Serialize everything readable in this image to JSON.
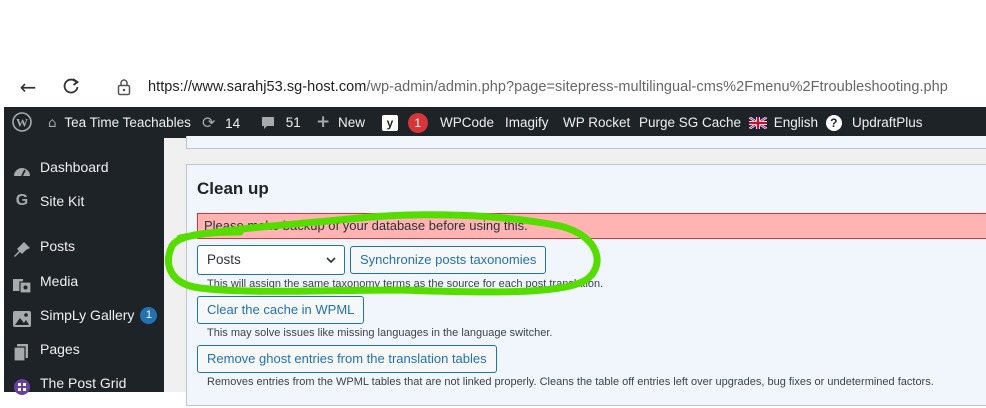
{
  "browser": {
    "url_host": "https://www.sarahj53.sg-host.com",
    "url_path": "/wp-admin/admin.php?page=sitepress-multilingual-cms%2Fmenu%2Ftroubleshooting.php",
    "icons": {
      "back": "back-arrow-icon",
      "reload": "reload-icon",
      "lock": "site-info-icon"
    }
  },
  "adminbar": {
    "site_name": "Tea Time Teachables",
    "updates_count": "14",
    "comments_count": "51",
    "new_label": "New",
    "yoast_count": "1",
    "wpcode": "WPCode",
    "imagify": "Imagify",
    "wp_rocket": "WP Rocket",
    "purge_cache": "Purge SG Cache",
    "language": "English",
    "help": "?",
    "updraft": "UpdraftPlus"
  },
  "sidebar": {
    "items": [
      {
        "label": "Dashboard",
        "icon": "dashboard-icon"
      },
      {
        "label": "Site Kit",
        "icon": "google-g-icon"
      },
      {
        "label": "Posts",
        "icon": "pin-icon"
      },
      {
        "label": "Media",
        "icon": "media-icon"
      },
      {
        "label": "SimpLy Gallery",
        "icon": "gallery-icon",
        "badge": "1"
      },
      {
        "label": "Pages",
        "icon": "pages-icon"
      },
      {
        "label": "The Post Grid",
        "icon": "grid-icon"
      }
    ]
  },
  "cleanup": {
    "title": "Clean up",
    "warning": "Please make backup of your database before using this.",
    "select_value": "Posts",
    "sync_button": "Synchronize posts taxonomies",
    "sync_help": "This will assign the same taxonomy terms as the source for each post translation.",
    "clear_button": "Clear the cache in WPML",
    "clear_help": "This may solve issues like missing languages in the language switcher.",
    "ghost_button": "Remove ghost entries from the translation tables",
    "ghost_help": "Removes entries from the WPML tables that are not linked properly. Cleans the table off entries left over upgrades, bug fixes or undetermined factors."
  },
  "colors": {
    "adminbar_bg": "#1d2327",
    "accent": "#2271b1",
    "warning_bg": "#ffb3b3",
    "annotation": "#55dd00"
  }
}
